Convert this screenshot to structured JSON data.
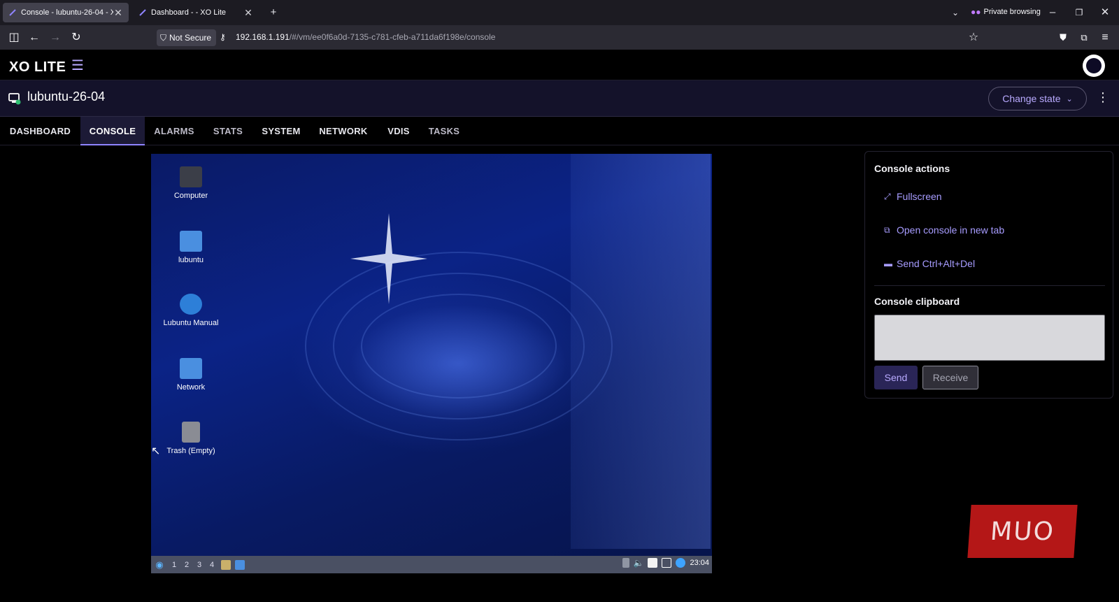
{
  "browser": {
    "tabs": [
      {
        "title": "Console - lubuntu-26-04 - XO L",
        "active": true
      },
      {
        "title": "Dashboard - - XO Lite",
        "active": false
      }
    ],
    "not_secure_label": "Not Secure",
    "url_host": "192.168.1.191",
    "url_path": "/#/vm/ee0f6a0d-7135-c781-cfeb-a711da6f198e/console",
    "private_label": "Private browsing"
  },
  "app": {
    "logo": "XO LITE",
    "vm_name": "lubuntu-26-04",
    "change_state_label": "Change state",
    "tabs": [
      "DASHBOARD",
      "CONSOLE",
      "ALARMS",
      "STATS",
      "SYSTEM",
      "NETWORK",
      "VDIS",
      "TASKS"
    ],
    "active_tab": "CONSOLE"
  },
  "console_screen": {
    "desktop_icons": [
      "Computer",
      "lubuntu",
      "Lubuntu Manual",
      "Network",
      "Trash (Empty)"
    ],
    "workspaces": [
      "1",
      "2",
      "3",
      "4"
    ],
    "clock": "23:04"
  },
  "panel": {
    "actions_title": "Console actions",
    "actions": [
      "Fullscreen",
      "Open console in new tab",
      "Send Ctrl+Alt+Del"
    ],
    "clipboard_title": "Console clipboard",
    "clipboard_value": "",
    "send_label": "Send",
    "receive_label": "Receive"
  },
  "watermark": "MUO",
  "colors": {
    "accent": "#a79cff",
    "background": "#000000",
    "header": "#14122a"
  }
}
